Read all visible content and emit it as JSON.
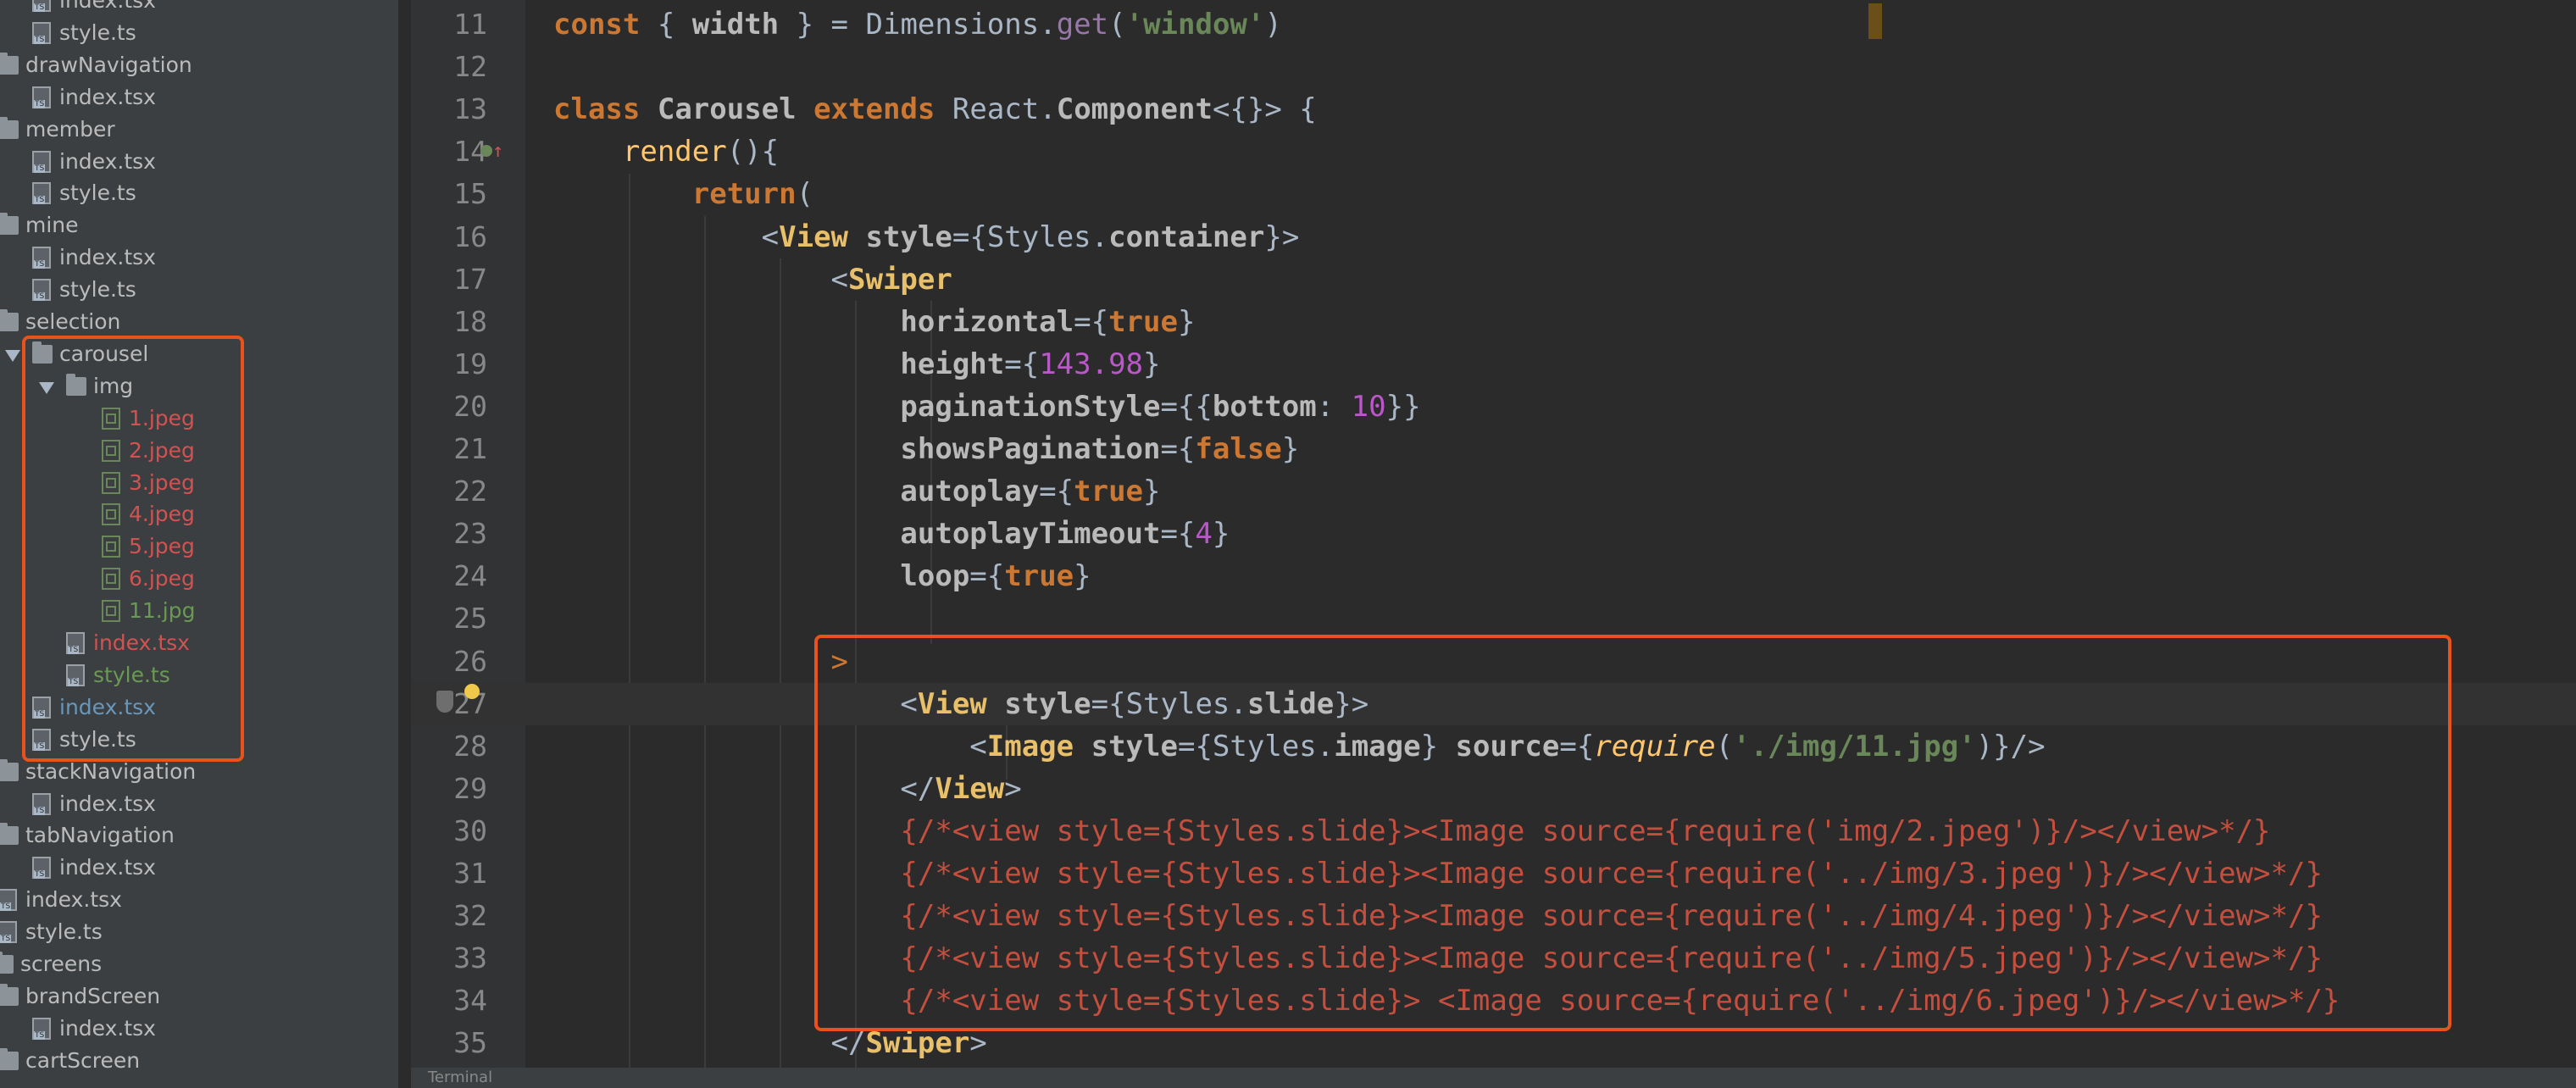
{
  "project_tree": {
    "items": [
      {
        "label": "index.tsx",
        "type": "file",
        "color": "default",
        "indent": 1
      },
      {
        "label": "style.ts",
        "type": "file",
        "color": "default",
        "indent": 1
      },
      {
        "label": "drawNavigation",
        "type": "folder",
        "color": "default",
        "indent": 0
      },
      {
        "label": "index.tsx",
        "type": "file",
        "color": "default",
        "indent": 1
      },
      {
        "label": "member",
        "type": "folder",
        "color": "default",
        "indent": 0
      },
      {
        "label": "index.tsx",
        "type": "file",
        "color": "default",
        "indent": 1
      },
      {
        "label": "style.ts",
        "type": "file",
        "color": "default",
        "indent": 1
      },
      {
        "label": "mine",
        "type": "folder",
        "color": "default",
        "indent": 0
      },
      {
        "label": "index.tsx",
        "type": "file",
        "color": "default",
        "indent": 1
      },
      {
        "label": "style.ts",
        "type": "file",
        "color": "default",
        "indent": 1
      },
      {
        "label": "selection",
        "type": "folder",
        "color": "default",
        "indent": 0
      },
      {
        "label": "carousel",
        "type": "folder",
        "color": "default",
        "indent": 1,
        "expanded": true
      },
      {
        "label": "img",
        "type": "folder",
        "color": "default",
        "indent": 2,
        "expanded": true
      },
      {
        "label": "1.jpeg",
        "type": "image",
        "color": "red",
        "indent": 3
      },
      {
        "label": "2.jpeg",
        "type": "image",
        "color": "red",
        "indent": 3
      },
      {
        "label": "3.jpeg",
        "type": "image",
        "color": "red",
        "indent": 3
      },
      {
        "label": "4.jpeg",
        "type": "image",
        "color": "red",
        "indent": 3
      },
      {
        "label": "5.jpeg",
        "type": "image",
        "color": "red",
        "indent": 3
      },
      {
        "label": "6.jpeg",
        "type": "image",
        "color": "red",
        "indent": 3
      },
      {
        "label": "11.jpg",
        "type": "image",
        "color": "green",
        "indent": 3
      },
      {
        "label": "index.tsx",
        "type": "file",
        "color": "red",
        "indent": 2
      },
      {
        "label": "style.ts",
        "type": "file",
        "color": "green",
        "indent": 2
      },
      {
        "label": "index.tsx",
        "type": "file",
        "color": "blue",
        "indent": 1
      },
      {
        "label": "style.ts",
        "type": "file",
        "color": "default",
        "indent": 1
      },
      {
        "label": "stackNavigation",
        "type": "folder",
        "color": "default",
        "indent": 0
      },
      {
        "label": "index.tsx",
        "type": "file",
        "color": "default",
        "indent": 1
      },
      {
        "label": "tabNavigation",
        "type": "folder",
        "color": "default",
        "indent": 0
      },
      {
        "label": "index.tsx",
        "type": "file",
        "color": "default",
        "indent": 1
      },
      {
        "label": "index.tsx",
        "type": "file",
        "color": "default",
        "indent": 0
      },
      {
        "label": "style.ts",
        "type": "file",
        "color": "default",
        "indent": 0
      },
      {
        "label": "screens",
        "type": "folder",
        "color": "default",
        "indent": -1
      },
      {
        "label": "brandScreen",
        "type": "folder",
        "color": "default",
        "indent": 0
      },
      {
        "label": "index.tsx",
        "type": "file",
        "color": "default",
        "indent": 1
      },
      {
        "label": "cartScreen",
        "type": "folder",
        "color": "default",
        "indent": 0
      }
    ]
  },
  "editor": {
    "current_line": 27,
    "lines": [
      {
        "num": 11,
        "tokens": [
          [
            "kw",
            "const"
          ],
          [
            "plain",
            " { "
          ],
          [
            "attr",
            "width"
          ],
          [
            "plain",
            " } = "
          ],
          [
            "type",
            "Dimensions"
          ],
          [
            "plain",
            "."
          ],
          [
            "mem",
            "get"
          ],
          [
            "plain",
            "("
          ],
          [
            "str",
            "'window'"
          ],
          [
            "plain",
            ")"
          ]
        ]
      },
      {
        "num": 12,
        "tokens": []
      },
      {
        "num": 13,
        "tokens": [
          [
            "kw",
            "class"
          ],
          [
            "plain",
            " "
          ],
          [
            "attr",
            "Carousel"
          ],
          [
            "plain",
            " "
          ],
          [
            "kw",
            "extends"
          ],
          [
            "plain",
            " "
          ],
          [
            "type",
            "React"
          ],
          [
            "plain",
            "."
          ],
          [
            "attr",
            "Component"
          ],
          [
            "plain",
            "<{}> {"
          ]
        ]
      },
      {
        "num": 14,
        "tokens": [
          [
            "plain",
            "    "
          ],
          [
            "fn",
            "render"
          ],
          [
            "plain",
            "(){"
          ]
        ]
      },
      {
        "num": 15,
        "tokens": [
          [
            "plain",
            "        "
          ],
          [
            "kw",
            "return"
          ],
          [
            "plain",
            "("
          ]
        ]
      },
      {
        "num": 16,
        "tokens": [
          [
            "plain",
            "            "
          ],
          [
            "plain",
            "<"
          ],
          [
            "jsx",
            "View"
          ],
          [
            "plain",
            " "
          ],
          [
            "attr",
            "style"
          ],
          [
            "plain",
            "={"
          ],
          [
            "type",
            "Styles"
          ],
          [
            "plain",
            "."
          ],
          [
            "attr",
            "container"
          ],
          [
            "plain",
            "}>"
          ]
        ]
      },
      {
        "num": 17,
        "tokens": [
          [
            "plain",
            "                "
          ],
          [
            "plain",
            "<"
          ],
          [
            "jsx",
            "Swiper"
          ]
        ]
      },
      {
        "num": 18,
        "tokens": [
          [
            "plain",
            "                    "
          ],
          [
            "attr",
            "horizontal"
          ],
          [
            "plain",
            "={"
          ],
          [
            "kw",
            "true"
          ],
          [
            "plain",
            "}"
          ]
        ]
      },
      {
        "num": 19,
        "tokens": [
          [
            "plain",
            "                    "
          ],
          [
            "attr",
            "height"
          ],
          [
            "plain",
            "={"
          ],
          [
            "num",
            "143.98"
          ],
          [
            "plain",
            "}"
          ]
        ]
      },
      {
        "num": 20,
        "tokens": [
          [
            "plain",
            "                    "
          ],
          [
            "attr",
            "paginationStyle"
          ],
          [
            "plain",
            "={{"
          ],
          [
            "attr",
            "bottom"
          ],
          [
            "plain",
            ": "
          ],
          [
            "num",
            "10"
          ],
          [
            "plain",
            "}}"
          ]
        ]
      },
      {
        "num": 21,
        "tokens": [
          [
            "plain",
            "                    "
          ],
          [
            "attr",
            "showsPagination"
          ],
          [
            "plain",
            "={"
          ],
          [
            "kw",
            "false"
          ],
          [
            "plain",
            "}"
          ]
        ]
      },
      {
        "num": 22,
        "tokens": [
          [
            "plain",
            "                    "
          ],
          [
            "attr",
            "autoplay"
          ],
          [
            "plain",
            "={"
          ],
          [
            "kw",
            "true"
          ],
          [
            "plain",
            "}"
          ]
        ]
      },
      {
        "num": 23,
        "tokens": [
          [
            "plain",
            "                    "
          ],
          [
            "attr",
            "autoplayTimeout"
          ],
          [
            "plain",
            "={"
          ],
          [
            "num",
            "4"
          ],
          [
            "plain",
            "}"
          ]
        ]
      },
      {
        "num": 24,
        "tokens": [
          [
            "plain",
            "                    "
          ],
          [
            "attr",
            "loop"
          ],
          [
            "plain",
            "={"
          ],
          [
            "kw",
            "true"
          ],
          [
            "plain",
            "}"
          ]
        ]
      },
      {
        "num": 25,
        "tokens": []
      },
      {
        "num": 26,
        "tokens": [
          [
            "plain",
            "                "
          ],
          [
            "kwn",
            ">"
          ]
        ]
      },
      {
        "num": 27,
        "tokens": [
          [
            "plain",
            "                    "
          ],
          [
            "plain",
            "<"
          ],
          [
            "jsx",
            "View"
          ],
          [
            "plain",
            " "
          ],
          [
            "attr",
            "style"
          ],
          [
            "plain",
            "={"
          ],
          [
            "type",
            "Styles"
          ],
          [
            "plain",
            "."
          ],
          [
            "attr",
            "slide"
          ],
          [
            "plain",
            "}>"
          ]
        ]
      },
      {
        "num": 28,
        "tokens": [
          [
            "plain",
            "                        "
          ],
          [
            "plain",
            "<"
          ],
          [
            "jsx",
            "Image"
          ],
          [
            "plain",
            " "
          ],
          [
            "attr",
            "style"
          ],
          [
            "plain",
            "={"
          ],
          [
            "type",
            "Styles"
          ],
          [
            "plain",
            "."
          ],
          [
            "attr",
            "image"
          ],
          [
            "plain",
            "} "
          ],
          [
            "attr",
            "source"
          ],
          [
            "plain",
            "={"
          ],
          [
            "italic",
            "require"
          ],
          [
            "plain",
            "("
          ],
          [
            "str",
            "'./img/11.jpg'"
          ],
          [
            "plain",
            ")}/>"
          ]
        ]
      },
      {
        "num": 29,
        "tokens": [
          [
            "plain",
            "                    "
          ],
          [
            "plain",
            "</"
          ],
          [
            "jsx",
            "View"
          ],
          [
            "plain",
            ">"
          ]
        ]
      },
      {
        "num": 30,
        "tokens": [
          [
            "plain",
            "                    "
          ],
          [
            "comment",
            "{/*<view style={Styles.slide}><Image source={require('img/2.jpeg')}/></view>*/}"
          ]
        ]
      },
      {
        "num": 31,
        "tokens": [
          [
            "plain",
            "                    "
          ],
          [
            "comment",
            "{/*<view style={Styles.slide}><Image source={require('../img/3.jpeg')}/></view>*/}"
          ]
        ]
      },
      {
        "num": 32,
        "tokens": [
          [
            "plain",
            "                    "
          ],
          [
            "comment",
            "{/*<view style={Styles.slide}><Image source={require('../img/4.jpeg')}/></view>*/}"
          ]
        ]
      },
      {
        "num": 33,
        "tokens": [
          [
            "plain",
            "                    "
          ],
          [
            "comment",
            "{/*<view style={Styles.slide}><Image source={require('../img/5.jpeg')}/></view>*/}"
          ]
        ]
      },
      {
        "num": 34,
        "tokens": [
          [
            "plain",
            "                    "
          ],
          [
            "comment",
            "{/*<view style={Styles.slide}> <Image source={require('../img/6.jpeg')}/></view>*/}"
          ]
        ]
      },
      {
        "num": 35,
        "tokens": [
          [
            "plain",
            "                "
          ],
          [
            "plain",
            "</"
          ],
          [
            "jsx",
            "Swiper"
          ],
          [
            "plain",
            ">"
          ]
        ]
      }
    ]
  },
  "status_bar": {
    "label": "Terminal"
  },
  "colors": {
    "highlight_box": "#e8521c",
    "background": "#2b2b2b"
  }
}
